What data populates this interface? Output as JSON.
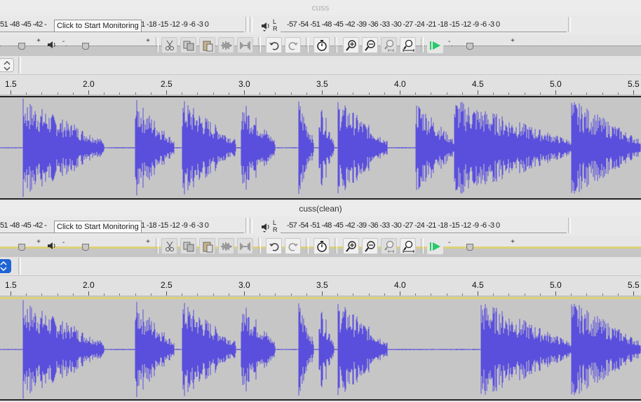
{
  "panes": [
    {
      "title": "cuss",
      "title_dimmed": true,
      "recording_meter": {
        "scale": "51 -48 -45 -42 -",
        "scale_tail": "1 -18 -15 -12  -9   -6   -3   0",
        "monitor_button_label": "Click to Start Monitoring"
      },
      "playback_meter": {
        "left_label": "L",
        "right_label": "R",
        "scale": "-57 -54 -51 -48 -45 -42 -39 -36 -33 -30 -27 -24 -21 -18 -15 -12  -9   -6   -3   0"
      },
      "selection_stepper": {
        "highlighted": false
      },
      "ruler": {
        "labels": [
          "1.5",
          "2.0",
          "2.5",
          "3.0",
          "3.5",
          "4.0",
          "4.5",
          "5.0",
          "5.5"
        ]
      },
      "waveform": {
        "color": "#5a4fdc",
        "bursts_seconds": [
          [
            1.58,
            2.1
          ],
          [
            1.9,
            1.92
          ],
          [
            2.3,
            2.55
          ],
          [
            2.6,
            2.95
          ],
          [
            2.98,
            3.2
          ],
          [
            3.35,
            3.45
          ],
          [
            3.48,
            3.58
          ],
          [
            3.6,
            3.92
          ],
          [
            4.1,
            4.35
          ],
          [
            4.35,
            5.1
          ],
          [
            5.1,
            5.55
          ]
        ]
      }
    },
    {
      "title": "cuss(clean)",
      "title_dimmed": false,
      "recording_meter": {
        "scale": "51 -48 -45 -42 -",
        "scale_tail": "1 -18 -15 -12  -9   -6   -3   0",
        "monitor_button_label": "Click to Start Monitoring"
      },
      "playback_meter": {
        "left_label": "L",
        "right_label": "R",
        "scale": "-57 -54 -51 -48 -45 -42 -39 -36 -33 -30 -27 -24 -21 -18 -15 -12  -9   -6   -3   0"
      },
      "selection_stepper": {
        "highlighted": true
      },
      "ruler": {
        "labels": [
          "1.5",
          "2.0",
          "2.5",
          "3.0",
          "3.5",
          "4.0",
          "4.5",
          "5.0",
          "5.5"
        ]
      },
      "waveform": {
        "color": "#5a4fdc",
        "bursts_seconds": [
          [
            1.58,
            2.1
          ],
          [
            1.9,
            1.92
          ],
          [
            2.3,
            2.55
          ],
          [
            2.6,
            2.95
          ],
          [
            2.98,
            3.2
          ],
          [
            3.35,
            3.45
          ],
          [
            3.48,
            3.58
          ],
          [
            3.6,
            3.92
          ],
          [
            4.52,
            5.1
          ],
          [
            5.1,
            5.55
          ]
        ]
      }
    }
  ],
  "icons": {
    "cut": "scissors-icon",
    "copy": "copy-icon",
    "paste": "paste-icon",
    "trim": "trim-audio-icon",
    "silence": "silence-audio-icon",
    "undo": "undo-icon",
    "redo": "redo-icon",
    "sync_lock": "sync-lock-icon",
    "zoom_in": "zoom-in-icon",
    "zoom_out": "zoom-out-icon",
    "fit_selection": "fit-selection-icon",
    "fit_project": "fit-project-icon",
    "play_at_speed": "play-at-speed-icon"
  },
  "colors": {
    "waveform": "#5a4fdc",
    "track_bg": "#c6c6c6",
    "play_green": "#27c96b",
    "selection_blue": "#1f64d4"
  }
}
